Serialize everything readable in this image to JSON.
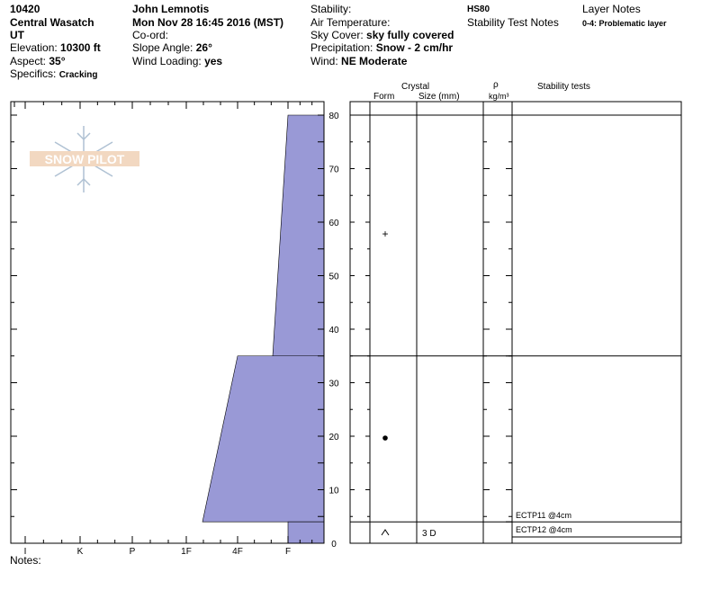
{
  "header": {
    "profile_id": "10420",
    "location": "Central Wasatch",
    "state": "UT",
    "elevation_label": "Elevation:",
    "elevation_value": "10300 ft",
    "aspect_label": "Aspect:",
    "aspect_value": "35°",
    "specifics_label": "Specifics:",
    "specifics_value": "Cracking",
    "observer": "John  Lemnotis",
    "datetime": "Mon Nov 28 16:45 2016 (MST)",
    "coord_label": "Co-ord:",
    "slope_label": "Slope Angle:",
    "slope_value": "26°",
    "wind_loading_label": "Wind Loading:",
    "wind_loading_value": "yes",
    "stability_label": "Stability:",
    "air_temp_label": "Air Temperature:",
    "sky_label": "Sky Cover:",
    "sky_value": "sky fully covered",
    "precip_label": "Precipitation:",
    "precip_value": "Snow - 2 cm/hr",
    "wind_label": "Wind:",
    "wind_value": "NE Moderate",
    "hs": "HS80",
    "stability_test_notes_label": "Stability Test Notes",
    "layer_notes_label": "Layer Notes",
    "layer_notes_value": "0-4: Problematic layer"
  },
  "logo": {
    "text": "SNOW PILOT"
  },
  "columns": {
    "crystal": "Crystal",
    "form": "Form",
    "size": "Size (mm)",
    "rho": "ρ",
    "rho_unit": "kg/m³",
    "stability_tests": "Stability tests"
  },
  "notes_label": "Notes:",
  "chart_data": {
    "type": "area",
    "title": "",
    "xlabel": "",
    "ylabel": "",
    "x_categories": [
      "I",
      "K",
      "P",
      "1F",
      "4F",
      "F"
    ],
    "x_reversed": true,
    "y_ticks": [
      0,
      10,
      20,
      30,
      40,
      50,
      60,
      70,
      80
    ],
    "ylim": [
      0,
      81
    ],
    "series": [
      {
        "type": "hardness_profile",
        "layers": [
          {
            "top_cm": 80,
            "bottom_cm": 35,
            "hardness_top": "F",
            "hardness_bottom": "F to 4F"
          },
          {
            "top_cm": 35,
            "bottom_cm": 4,
            "hardness_top": "4F",
            "hardness_bottom": "1F-"
          },
          {
            "top_cm": 4,
            "bottom_cm": 0,
            "hardness_top": "F",
            "hardness_bottom": "F"
          }
        ]
      }
    ],
    "layer_boundaries_cm": [
      80,
      35,
      4,
      0
    ],
    "layers": [
      {
        "top_cm": 80,
        "bottom_cm": 35,
        "form_symbol": "+",
        "size": ""
      },
      {
        "top_cm": 35,
        "bottom_cm": 4,
        "form_symbol": "●",
        "size": ""
      },
      {
        "top_cm": 4,
        "bottom_cm": 0,
        "form_symbol": "^",
        "size": "3 D"
      }
    ],
    "stability_tests": [
      {
        "label": "ECTP11 @4cm"
      },
      {
        "label": "ECTP12 @4cm"
      }
    ],
    "colors": {
      "fill": "#9999d6",
      "stroke": "#000000"
    }
  }
}
